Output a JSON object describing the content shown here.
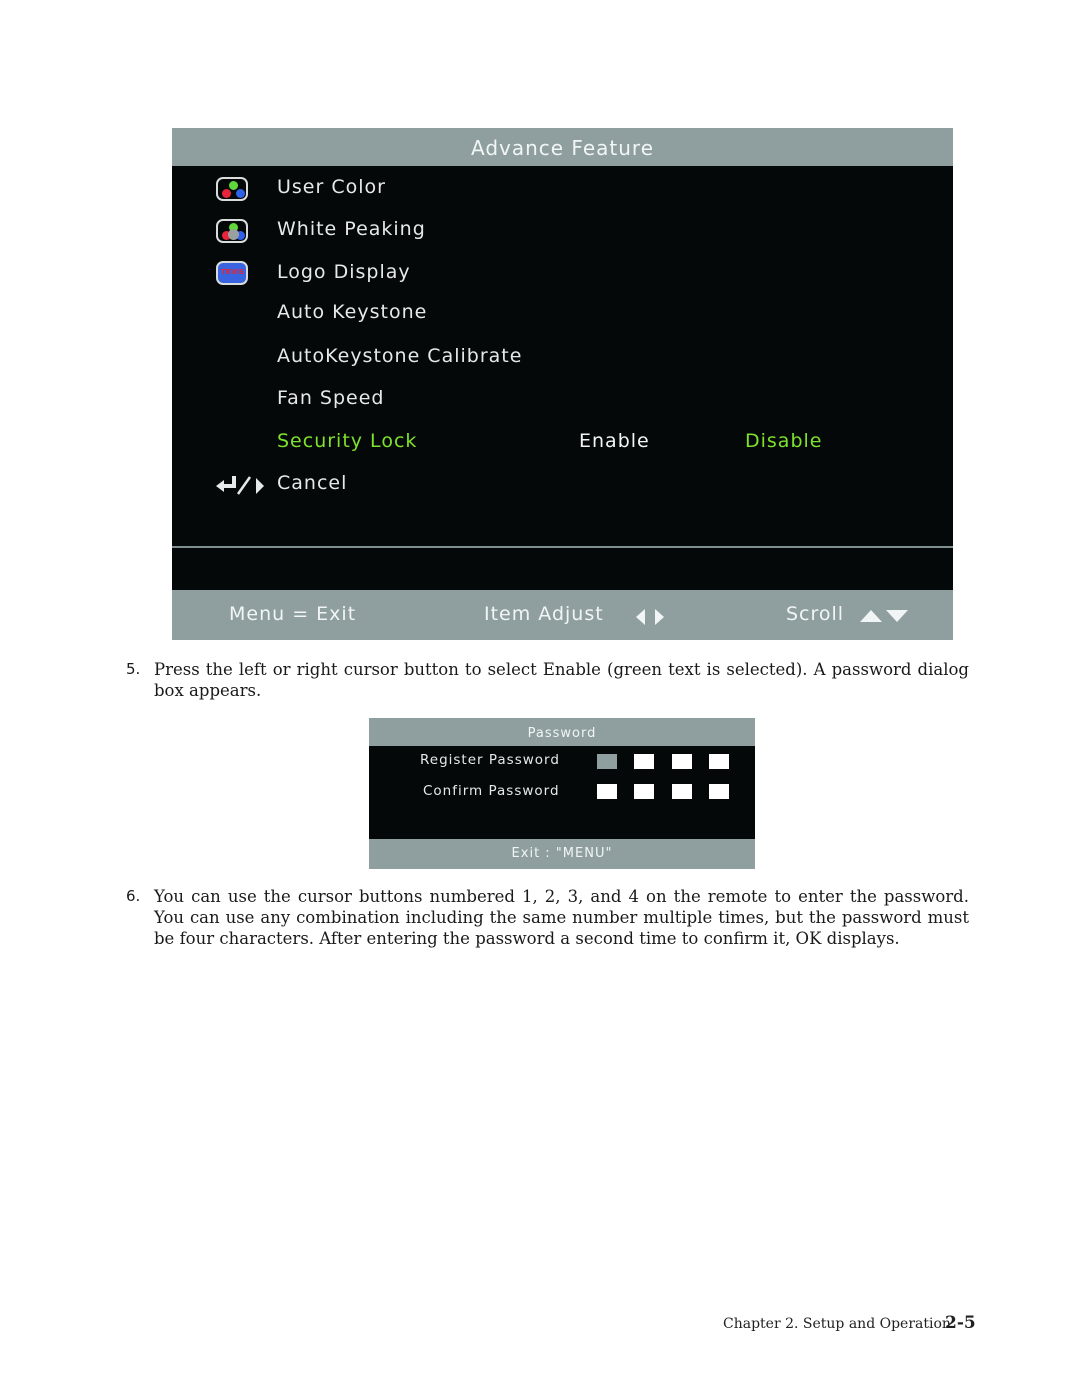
{
  "osd_menu": {
    "title": "Advance Feature",
    "items": [
      {
        "label": "User Color",
        "icon": "rgb-dots-icon"
      },
      {
        "label": "White Peaking",
        "icon": "rgb-dots-white-icon"
      },
      {
        "label": "Logo Display",
        "icon": "logo-icon"
      },
      {
        "label": "Auto Keystone",
        "icon": ""
      },
      {
        "label": "AutoKeystone Calibrate",
        "icon": ""
      },
      {
        "label": "Fan Speed",
        "icon": ""
      },
      {
        "label": "Security Lock",
        "icon": "",
        "selected": true
      },
      {
        "label": "Cancel",
        "icon": "enter-return-icon"
      }
    ],
    "security_lock_options": {
      "enable": "Enable",
      "disable": "Disable",
      "selected": "Disable"
    },
    "logo_icon_text": "TRVIS",
    "footer": {
      "menu_exit": "Menu = Exit",
      "item_adjust": "Item Adjust",
      "scroll": "Scroll"
    },
    "colors": {
      "highlight": "#7de22b",
      "bar": "#8f9f9f",
      "background": "#050809"
    }
  },
  "steps": [
    {
      "number": "5.",
      "text": "Press the left or right cursor button to select Enable (green text is selected). A password dialog box appears."
    },
    {
      "number": "6.",
      "text": "You can use the cursor buttons numbered 1, 2, 3, and 4 on the remote to enter the password. You can use any combination including the same number multiple times, but the password must be four characters. After entering the password a second time to confirm it, OK displays."
    }
  ],
  "password_dialog": {
    "title": "Password",
    "register_label": "Register Password",
    "confirm_label": "Confirm Password",
    "exit_label": "Exit : \"MENU\"",
    "digits": 4
  },
  "page_footer": {
    "chapter": "Chapter 2. Setup and Operation",
    "page_number": "2-5"
  }
}
